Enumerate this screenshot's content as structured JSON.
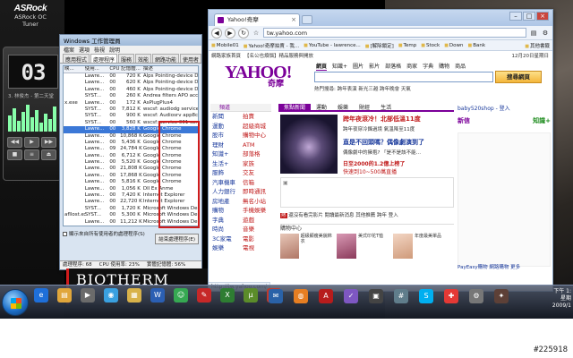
{
  "desktop": {
    "asrock_logo": "ASRock",
    "asrock_sub1": "ASRock OC",
    "asrock_sub2": "Tuner",
    "player_time": "03",
    "player_track": "3. 林俊杰 - 第二天堂",
    "player_buttons": [
      "◀◀",
      "▶",
      "▶▶",
      "■",
      "≡",
      "⏏"
    ],
    "biotherm": "BIOTHERM"
  },
  "taskmgr": {
    "title": "Windows 工作管理員",
    "menus": [
      "檔案",
      "選項",
      "檢視",
      "說明"
    ],
    "tabs": [
      "應用程式",
      "處理程序",
      "服務",
      "效能",
      "網路功能",
      "使用者"
    ],
    "active_tab": 1,
    "columns": [
      "映...",
      "使用...",
      "CPU",
      "記憶體...",
      "描述"
    ],
    "rows": [
      [
        "",
        "Lawre...",
        "00",
        "720 K",
        "Alps Pointing-device D"
      ],
      [
        "",
        "Lawre...",
        "00",
        "620 K",
        "Alps Pointing-device D"
      ],
      [
        "",
        "Lawre...",
        "00",
        "460 K",
        "Alps Pointing-device D"
      ],
      [
        "",
        "SYST...",
        "00",
        "260 K",
        "Andrea filters APO acc"
      ],
      [
        "x.exe",
        "Lawre...",
        "00",
        "172 K",
        "AsPlugPlus4"
      ],
      [
        "",
        "SYST...",
        "00",
        "7,812 K",
        "wscsf: audiodg service"
      ],
      [
        "",
        "SYST...",
        "00",
        "900 K",
        "wscsf: Audiosrv app8c"
      ],
      [
        "",
        "SYST...",
        "00",
        "560 K",
        "wscsf: service 001 serv"
      ],
      [
        "",
        "Lawre...",
        "00",
        "3,828 K",
        "Google Chrome"
      ],
      [
        "",
        "Lawre...",
        "00",
        "10,868 K",
        "Google Chrome"
      ],
      [
        "",
        "Lawre...",
        "00",
        "5,436 K",
        "Google Chrome"
      ],
      [
        "",
        "Lawre...",
        "09",
        "24,784 K",
        "Google Chrome"
      ],
      [
        "",
        "Lawre...",
        "00",
        "6,712 K",
        "Google Chrome"
      ],
      [
        "",
        "Lawre...",
        "00",
        "5,520 K",
        "Google Chrome"
      ],
      [
        "",
        "Lawre...",
        "00",
        "21,808 K",
        "Google Chrome"
      ],
      [
        "",
        "Lawre...",
        "00",
        "17,868 K",
        "Google Chrome"
      ],
      [
        "",
        "Lawre...",
        "00",
        "5,816 K",
        "Google Chrome"
      ],
      [
        "",
        "Lawre...",
        "00",
        "1,056 K",
        "Dll Ex Anme"
      ],
      [
        "",
        "Lawre...",
        "00",
        "7,420 K",
        "Internet Explorer"
      ],
      [
        "",
        "Lawre...",
        "00",
        "22,720 K",
        "Internet Explorer"
      ],
      [
        "",
        "SYST...",
        "00",
        "1,720 K",
        "Microsoft Windows De..."
      ],
      [
        "afllost.exe",
        "SYST...",
        "00",
        "5,300 K",
        "Microsoft Windows De..."
      ],
      [
        "",
        "Lawre...",
        "00",
        "11,212 K",
        "Microsoft Windows De..."
      ]
    ],
    "selected_row": 8,
    "show_all_label": "顯示來自所有使用者的處理程序(S)",
    "end_process": "結束處理程序(E)",
    "status": [
      "處理程序: 68",
      "CPU 使用率: 23%",
      "實體記憶體: 56%"
    ]
  },
  "chrome": {
    "tab_title": "Yahoo!奇摩",
    "url": "tw.yahoo.com",
    "bookmarks": [
      "Mobile01",
      "Yahoo!奇摩拍賣 - 我...",
      "YouTube - lawrence...",
      "[解除鎖定]",
      "Temp",
      "Stock",
      "Down",
      "Bank"
    ],
    "bookmarks_more": "其他書籤",
    "status_url": "http://tw.yahoo.com/"
  },
  "yahoo": {
    "topline": [
      "網路家族首頁",
      "【名公也煩惱】精品服務與開放"
    ],
    "date": "12月20日星期日",
    "logo": "YAHOO!",
    "logo_zh": "奇摩",
    "search_tabs": [
      "網頁",
      "知識+",
      "圖片",
      "影片",
      "部落格",
      "商家",
      "字典",
      "購物",
      "商品"
    ],
    "search_button": "搜尋網頁",
    "hot_search": "熱門搜尋: 跨年表演  新光三越  跨年晚會  天氣",
    "left_head": "頻道",
    "nav_col1": [
      "新聞",
      "運動",
      "股市",
      "理財",
      "知識+",
      "生活+",
      "服飾",
      "汽車機車",
      "人力銀行",
      "房地產",
      "購物",
      "字典",
      "時尚",
      "3C家電",
      "娛樂"
    ],
    "nav_col2": [
      "拍賣",
      "超級商城",
      "購物中心",
      "ATM",
      "部落格",
      "家族",
      "交友",
      "信箱",
      "即時通訊",
      "無名小站",
      "手機娛樂",
      "遊戲",
      "音樂",
      "電影",
      "電視"
    ],
    "center_tabs": [
      "焦點新聞",
      "運動",
      "娛樂",
      "財經",
      "生活"
    ],
    "headline1": "跨年夜滾冷！北部低溫11度",
    "sub1": "跨年夜穿冷鋒過境 氣溫降至11度",
    "headline2": "直是不回頭嗎？偶像劇演到了",
    "sub2": "偶像劇中的擁抱? 「是不是該不能…",
    "promo1": "日至2000的1.2億上榜了",
    "promo2": "快速到10~500萬直播",
    "ticker_tag": "熱",
    "ticker": "還沒有看完影片 閱讀最新消息 其他推薦 跨年 登入",
    "shop_title": "購物中心",
    "shop_items": [
      "超級顯瘦美貌棉衣",
      "美式印花T恤",
      "年度最美單品"
    ],
    "right_user": "baby520shop - 登入",
    "mail_new": "新信",
    "mail_knowledge": "知識+",
    "payeasy": "PayEasy購物 網路購物 更多",
    "right_more": "更多好康"
  },
  "taskbar": {
    "icons": [
      "ie",
      "folder",
      "media",
      "chrome",
      "explorer",
      "word",
      "messenger",
      "pdf",
      "excel",
      "torrent",
      "music",
      "mail",
      "firefox",
      "acrobat",
      "notes",
      "video",
      "calc",
      "skype",
      "paint",
      "settings",
      "misc"
    ],
    "time": "下午 1:",
    "date": "2009/1",
    "weekday": "星期"
  },
  "watermark": "#225918"
}
